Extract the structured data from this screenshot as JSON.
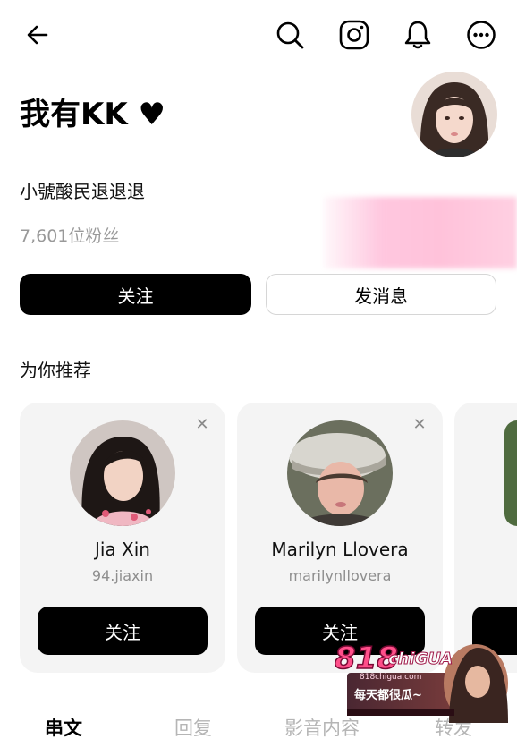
{
  "header": {
    "back_icon": "arrow-left-icon",
    "search_icon": "search-icon",
    "instagram_icon": "instagram-icon",
    "bell_icon": "bell-icon",
    "more_icon": "more-horizontal-icon"
  },
  "profile": {
    "name": "我有KK ♥",
    "bio": "小號酸民退退退",
    "followers": "7,601位粉丝",
    "follow_label": "关注",
    "message_label": "发消息"
  },
  "recommendations": {
    "title": "为你推荐",
    "cards": [
      {
        "name": "Jia Xin",
        "handle": "94.jiaxin",
        "button": "关注"
      },
      {
        "name": "Marilyn Llovera",
        "handle": "marilynllovera",
        "button": "关注"
      }
    ]
  },
  "tabs": [
    {
      "label": "串文",
      "active": true
    },
    {
      "label": "回复",
      "active": false
    },
    {
      "label": "影音内容",
      "active": false
    },
    {
      "label": "转发",
      "active": false
    }
  ],
  "ad": {
    "logo": "818",
    "brand": "chiGUA",
    "url": "818chigua.com",
    "slogan": "每天都很瓜~"
  },
  "colors": {
    "primary_button": "#000000",
    "card_bg": "#f4f4f4",
    "muted_text": "#999999"
  }
}
